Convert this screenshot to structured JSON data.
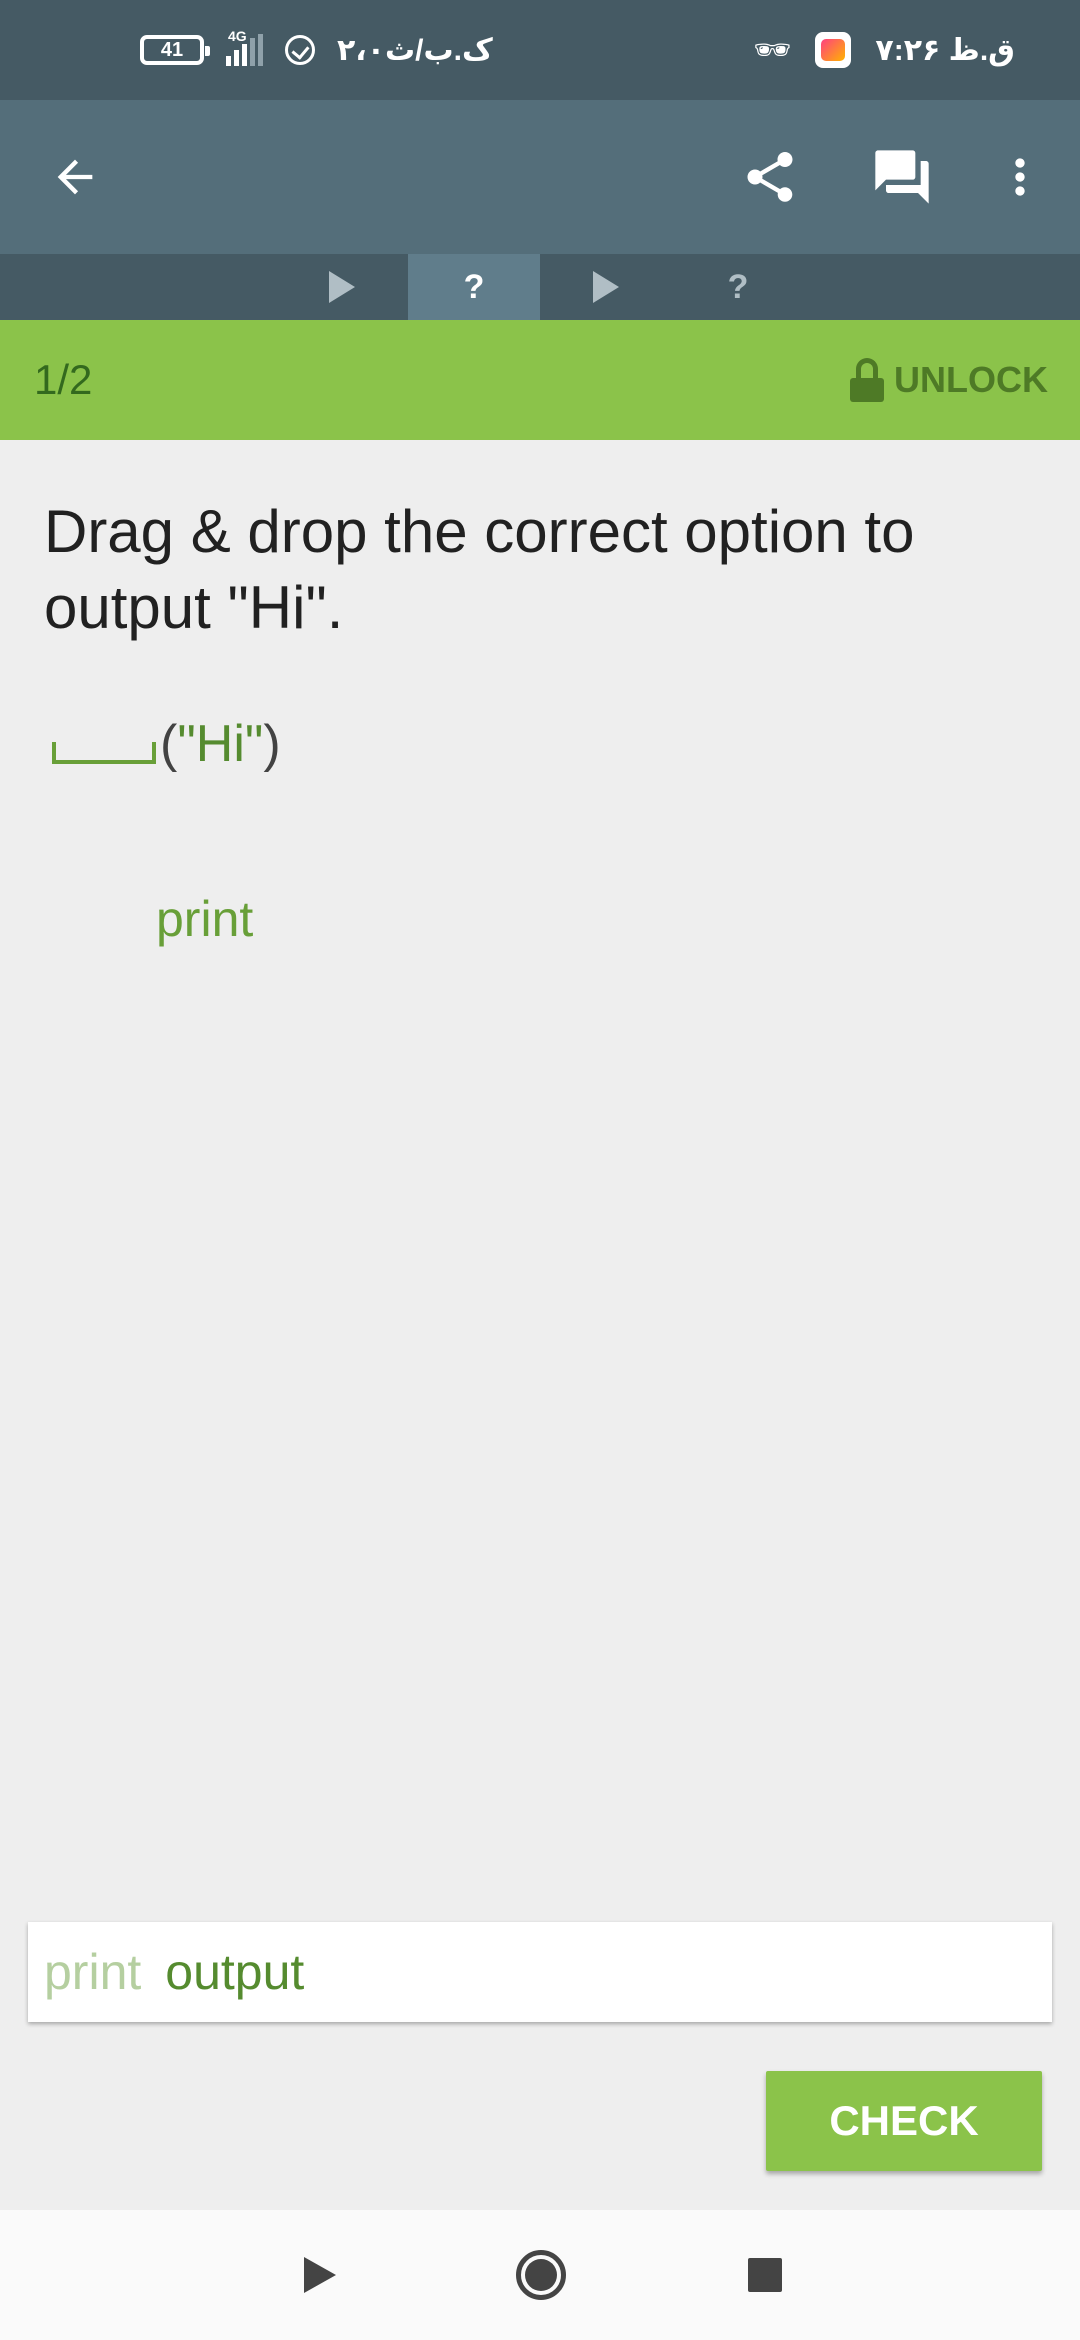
{
  "status_bar": {
    "battery": "41",
    "network": "4G",
    "left_time": "۲،۰ک.ب/ث",
    "right_time": "۷:۲۶ ق.ظ"
  },
  "toolbar": {
    "back_icon": "arrow-left-icon",
    "share_icon": "share-icon",
    "chat_icon": "chat-icon",
    "more_icon": "more-vert-icon"
  },
  "tabs": [
    {
      "type": "play",
      "label": "",
      "active": false
    },
    {
      "type": "question",
      "label": "?",
      "active": true
    },
    {
      "type": "play",
      "label": "",
      "active": false
    },
    {
      "type": "question",
      "label": "?",
      "active": false
    }
  ],
  "progress": {
    "count": "1/2",
    "unlock_label": "UNLOCK"
  },
  "question": {
    "text": "Drag & drop the correct option to output \"Hi\".",
    "code_open": "(",
    "code_string": "\"Hi\"",
    "code_close": ")",
    "dropped_option": "print"
  },
  "options": {
    "used": "print",
    "available": "output"
  },
  "actions": {
    "check_label": "CHECK"
  },
  "colors": {
    "toolbar": "#546e7a",
    "status_bar": "#455a64",
    "accent_green": "#8bc34a",
    "code_green": "#689f38"
  }
}
